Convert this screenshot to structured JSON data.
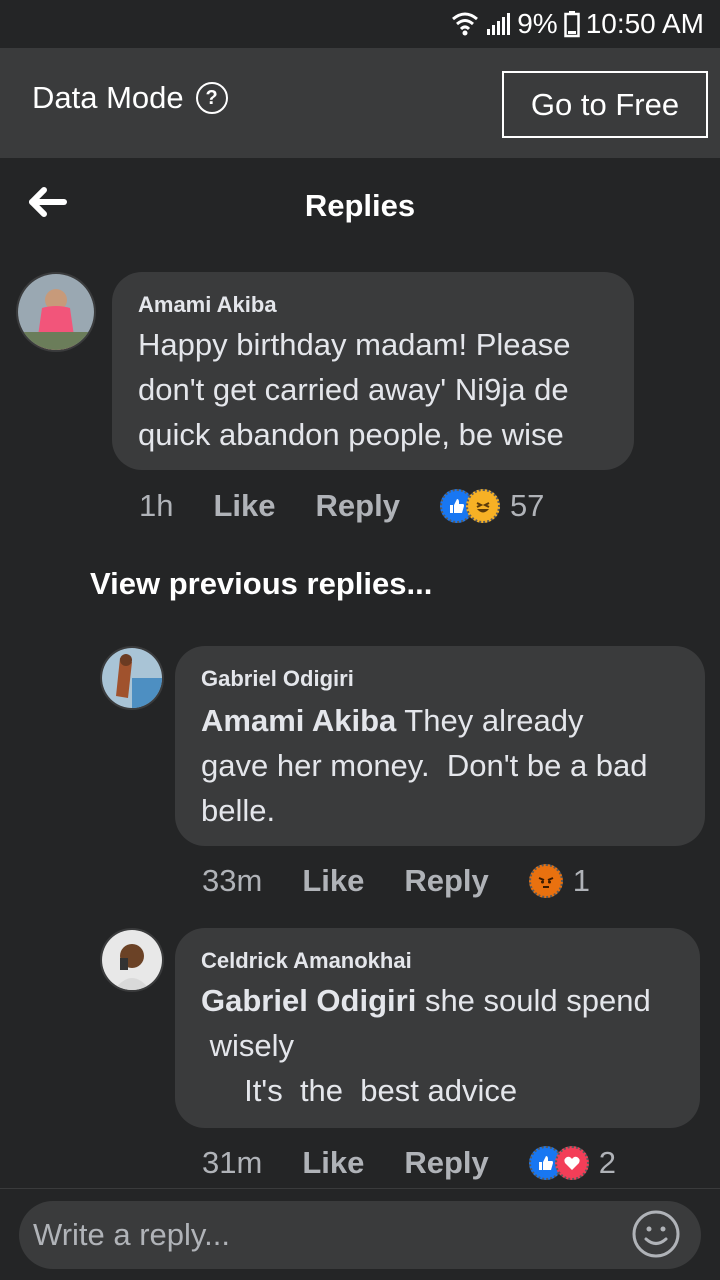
{
  "status_bar": {
    "battery": "9%",
    "time": "10:50 AM"
  },
  "data_banner": {
    "label": "Data Mode",
    "help_glyph": "?",
    "button": "Go to Free"
  },
  "header": {
    "title": "Replies"
  },
  "comment": {
    "author": "Amami Akiba",
    "text": "Happy birthday madam! Please\ndon't get carried away' Ni9ja de\nquick abandon people, be wise",
    "time": "1h",
    "like": "Like",
    "reply": "Reply",
    "reaction_count": "57",
    "reaction_icons": [
      "like-icon",
      "haha-icon"
    ]
  },
  "view_previous": "View previous replies...",
  "replies": [
    {
      "author": "Gabriel Odigiri",
      "mention": "Amami Akiba",
      "text_line1": " They already",
      "text_rest": "gave her money.  Don't be a bad\nbelle.",
      "time": "33m",
      "like": "Like",
      "reply": "Reply",
      "reaction_count": "1",
      "reaction_icons": [
        "angry-icon"
      ]
    },
    {
      "author": "Celdrick Amanokhai",
      "mention": "Gabriel Odigiri",
      "text_line1": " she sould spend",
      "text_rest": " wisely\n     It's  the  best advice",
      "time": "31m",
      "like": "Like",
      "reply": "Reply",
      "reaction_count": "2",
      "reaction_icons": [
        "like-icon",
        "love-icon"
      ]
    }
  ],
  "reply_bar": {
    "placeholder": "Write a reply..."
  },
  "colors": {
    "background": "#242526",
    "bubble": "#3a3b3c",
    "banner": "#3a3b3c",
    "text": "#e4e6eb",
    "muted": "#b0b3b8",
    "like_blue": "#1877f2",
    "love_red": "#f33e58",
    "haha_yellow": "#f7b125"
  }
}
